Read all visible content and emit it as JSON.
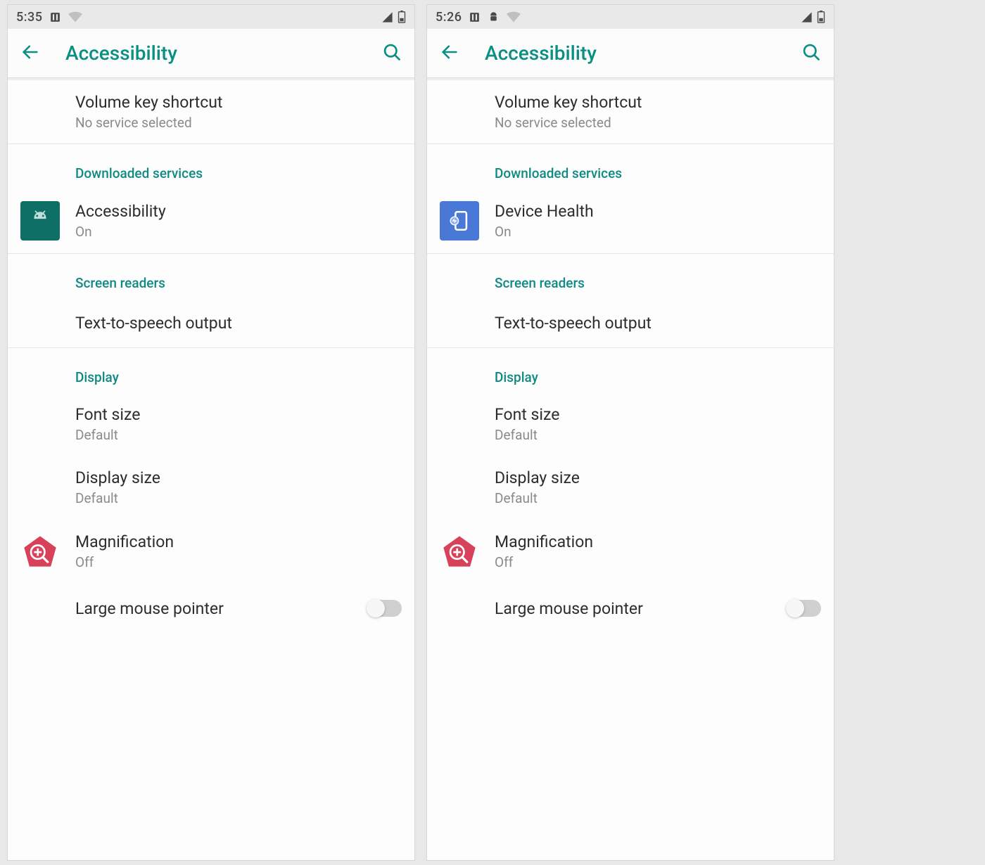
{
  "screens": [
    {
      "status": {
        "time": "5:35"
      },
      "app_bar": {
        "title": "Accessibility"
      },
      "volume_key": {
        "title": "Volume key shortcut",
        "subtitle": "No service selected"
      },
      "section_downloaded": "Downloaded services",
      "downloaded_app": {
        "title": "Accessibility",
        "subtitle": "On",
        "icon": "android"
      },
      "section_screen_readers": "Screen readers",
      "tts": {
        "title": "Text-to-speech output"
      },
      "section_display": "Display",
      "font_size": {
        "title": "Font size",
        "subtitle": "Default"
      },
      "display_size": {
        "title": "Display size",
        "subtitle": "Default"
      },
      "magnification": {
        "title": "Magnification",
        "subtitle": "Off"
      },
      "large_pointer": {
        "title": "Large mouse pointer",
        "value": false
      }
    },
    {
      "status": {
        "time": "5:26"
      },
      "app_bar": {
        "title": "Accessibility"
      },
      "volume_key": {
        "title": "Volume key shortcut",
        "subtitle": "No service selected"
      },
      "section_downloaded": "Downloaded services",
      "downloaded_app": {
        "title": "Device Health",
        "subtitle": "On",
        "icon": "device-health"
      },
      "section_screen_readers": "Screen readers",
      "tts": {
        "title": "Text-to-speech output"
      },
      "section_display": "Display",
      "font_size": {
        "title": "Font size",
        "subtitle": "Default"
      },
      "display_size": {
        "title": "Display size",
        "subtitle": "Default"
      },
      "magnification": {
        "title": "Magnification",
        "subtitle": "Off"
      },
      "large_pointer": {
        "title": "Large mouse pointer",
        "value": false
      }
    }
  ]
}
